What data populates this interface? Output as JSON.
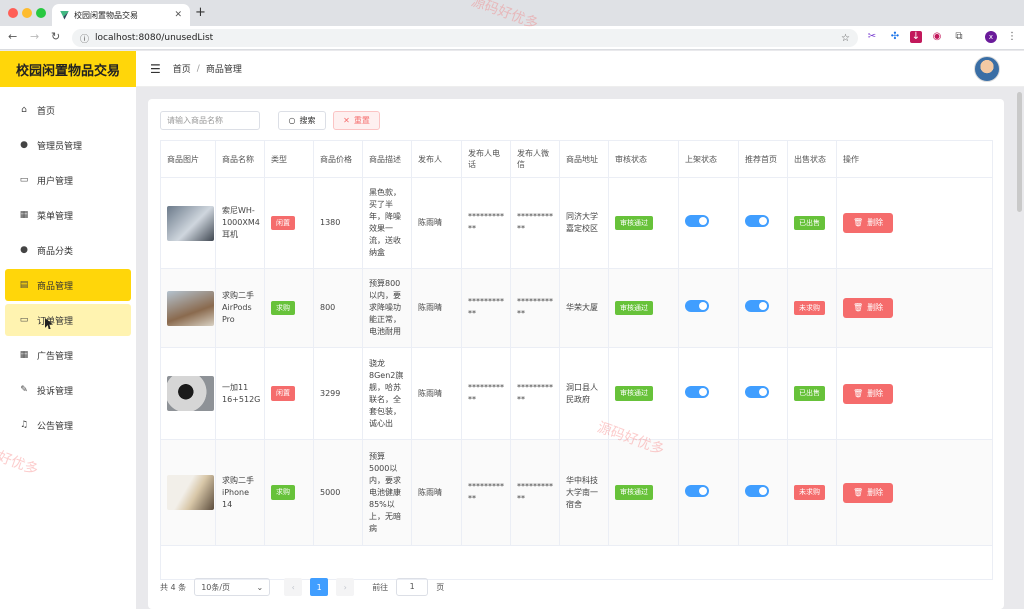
{
  "browser": {
    "tab_title": "校园闲置物品交易",
    "url": "localhost:8080/unusedList"
  },
  "sidebar": {
    "brand": "校园闲置物品交易",
    "items": [
      {
        "label": "首页",
        "icon": "home-icon"
      },
      {
        "label": "管理员管理",
        "icon": "user-icon"
      },
      {
        "label": "用户管理",
        "icon": "folder-icon"
      },
      {
        "label": "菜单管理",
        "icon": "grid-icon"
      },
      {
        "label": "商品分类",
        "icon": "user-icon"
      },
      {
        "label": "商品管理",
        "icon": "document-icon"
      },
      {
        "label": "订单管理",
        "icon": "monitor-icon"
      },
      {
        "label": "广告管理",
        "icon": "calendar-icon"
      },
      {
        "label": "投诉管理",
        "icon": "edit-icon"
      },
      {
        "label": "公告管理",
        "icon": "bell-icon"
      }
    ]
  },
  "header": {
    "breadcrumb_home": "首页",
    "breadcrumb_current": "商品管理"
  },
  "filters": {
    "name_placeholder": "请输入商品名称",
    "search_label": "搜索",
    "reset_label": "重置"
  },
  "table": {
    "columns": [
      "商品图片",
      "商品名称",
      "类型",
      "商品价格",
      "商品描述",
      "发布人",
      "发布人电话",
      "发布人微信",
      "商品地址",
      "审核状态",
      "上架状态",
      "推荐首页",
      "出售状态",
      "操作"
    ],
    "delete_label": "删除",
    "rows": [
      {
        "name": "索尼WH-1000XM4耳机",
        "type": "闲置",
        "price": "1380",
        "desc": "黑色款，买了半年，降噪效果一流，送收纳盒",
        "publisher": "陈雨晴",
        "phone": "***********",
        "wechat": "***********",
        "address": "同济大学嘉定校区",
        "audit": "审核通过",
        "sale": "已出售"
      },
      {
        "name": "求购二手AirPods Pro",
        "type": "求购",
        "price": "800",
        "desc": "预算800以内，要求降噪功能正常，电池耐用",
        "publisher": "陈雨晴",
        "phone": "***********",
        "wechat": "***********",
        "address": "华荣大厦",
        "audit": "审核通过",
        "sale": "未求购"
      },
      {
        "name": "一加11 16+512G",
        "type": "闲置",
        "price": "3299",
        "desc": "骁龙8Gen2旗舰，哈苏联名，全套包装，诚心出",
        "publisher": "陈雨晴",
        "phone": "***********",
        "wechat": "***********",
        "address": "洞口县人民政府",
        "audit": "审核通过",
        "sale": "已出售"
      },
      {
        "name": "求购二手iPhone 14",
        "type": "求购",
        "price": "5000",
        "desc": "预算5000以内，要求电池健康85%以上，无暗病",
        "publisher": "陈雨晴",
        "phone": "***********",
        "wechat": "***********",
        "address": "华中科技大学南一宿舍",
        "audit": "审核通过",
        "sale": "未求购"
      }
    ]
  },
  "pagination": {
    "total": "共 4 条",
    "page_size": "10条/页",
    "current_page": "1",
    "goto_label": "前往",
    "goto_value": "1",
    "page_suffix": "页"
  },
  "watermark": "源码好优多"
}
